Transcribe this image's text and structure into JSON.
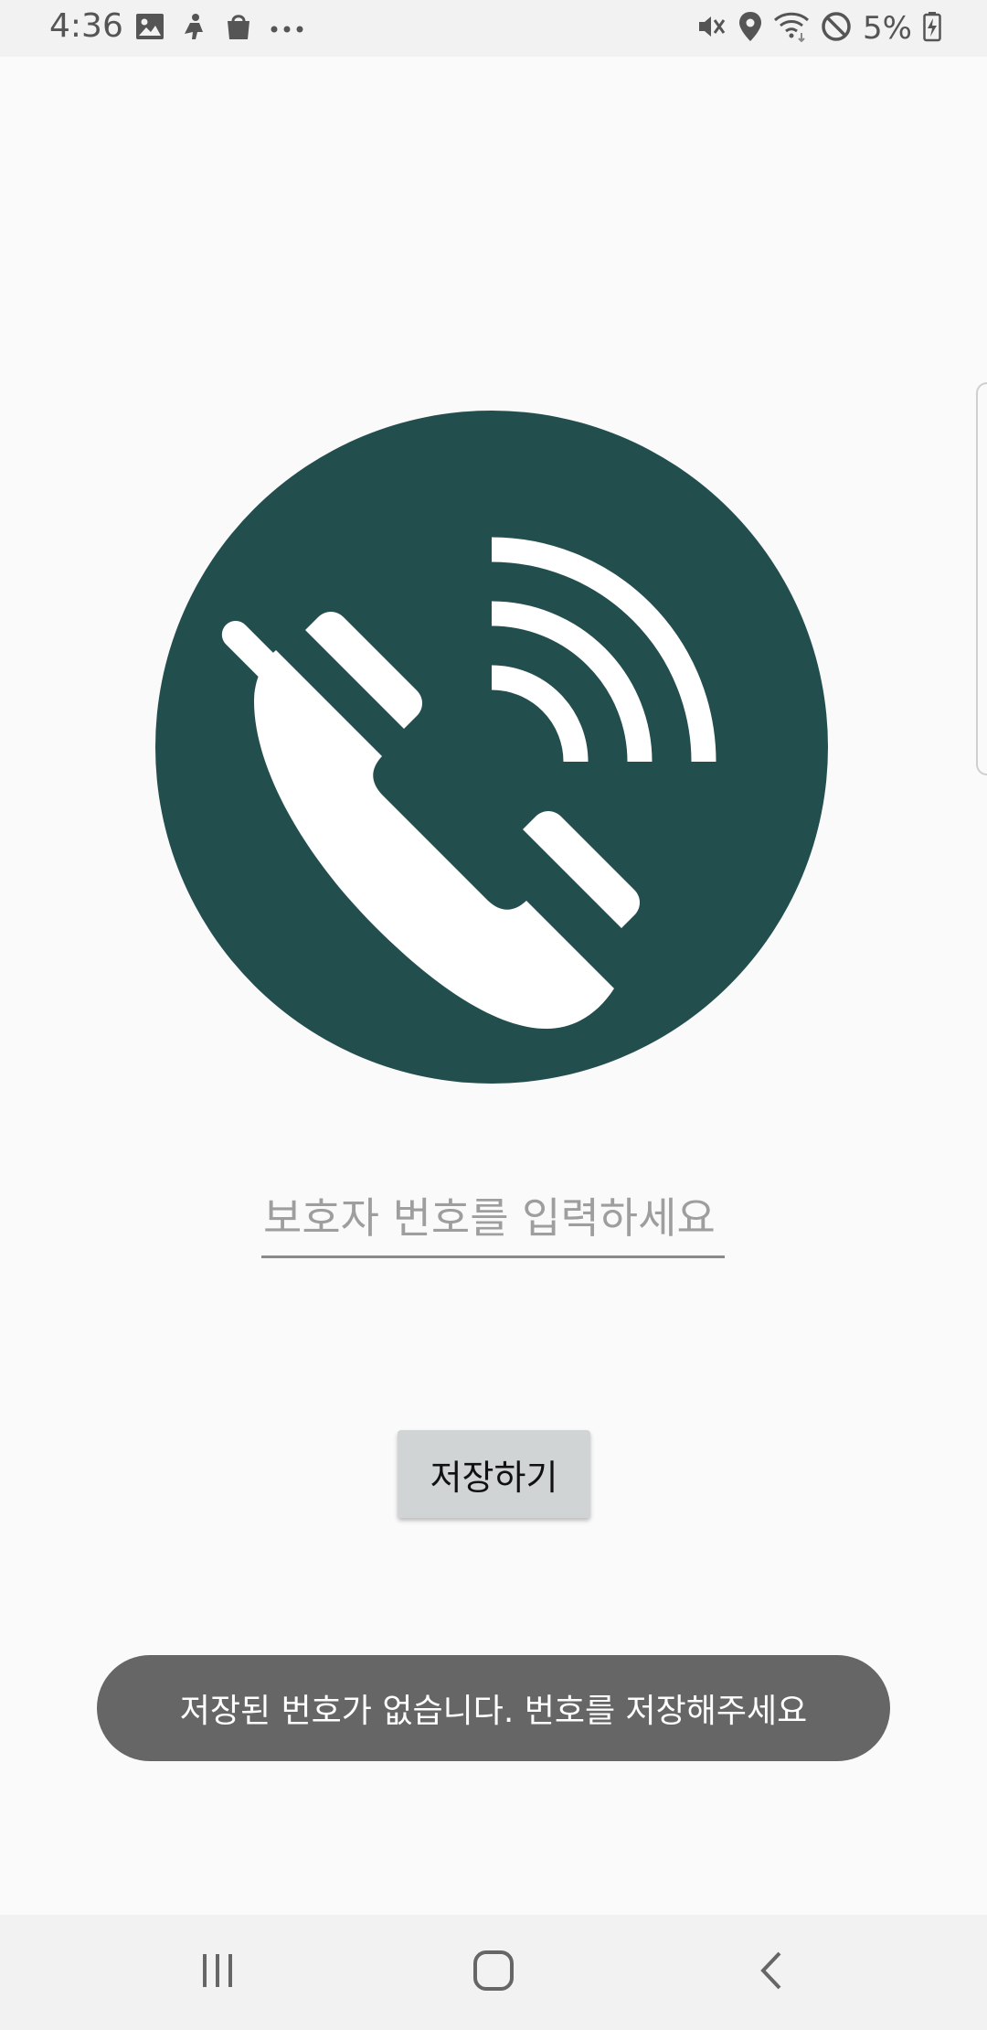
{
  "status_bar": {
    "time": "4:36",
    "battery": "5%",
    "left_icons": [
      "gallery-icon",
      "game-launcher-icon",
      "shopping-bag-icon",
      "more-dots-icon"
    ],
    "right_icons": [
      "mute-vibrate-icon",
      "location-icon",
      "wifi-icon",
      "do-not-disturb-icon",
      "battery-charging-icon"
    ]
  },
  "main": {
    "logo_icon": "phone-ringing-icon",
    "logo_color": "#224e4d",
    "input": {
      "placeholder": "보호자 번호를 입력하세요",
      "value": ""
    },
    "save_button_label": "저장하기"
  },
  "toast": {
    "message": "저장된 번호가 없습니다. 번호를 저장해주세요"
  },
  "nav_bar": {
    "buttons": [
      "recent-apps-icon",
      "home-icon",
      "back-icon"
    ]
  }
}
